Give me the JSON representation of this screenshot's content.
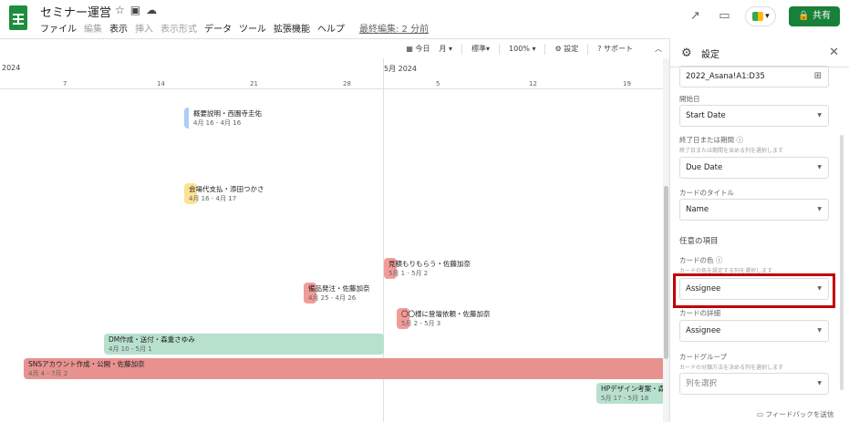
{
  "app": {
    "title": "セミナー運営",
    "menu": [
      "ファイル",
      "編集",
      "表示",
      "挿入",
      "表示形式",
      "データ",
      "ツール",
      "拡張機能",
      "ヘルプ"
    ],
    "menu_disabled": [
      "編集",
      "挿入",
      "表示形式"
    ],
    "last_edit": "最終編集: 2 分前",
    "share_label": "共有"
  },
  "toolbar": {
    "today": "今日",
    "scale": "月",
    "density": "標準",
    "zoom": "100%",
    "settings": "設定",
    "support": "サポート"
  },
  "timeline": {
    "left_month": "2024",
    "month": "5月 2024",
    "days": [
      "7",
      "14",
      "21",
      "28",
      "5",
      "12",
      "19"
    ],
    "cards": [
      {
        "name": "概要説明・西園寺圭佑",
        "dates": "4月 16 - 4月 16",
        "color": "#aecbfa"
      },
      {
        "name": "会場代支払・添田つかさ",
        "dates": "4月 16 - 4月 17",
        "color": "#fde293"
      },
      {
        "name": "見積もりもらう・佐藤加奈",
        "dates": "5月 1 - 5月 2",
        "color": "#f19c99"
      },
      {
        "name": "備品発注・佐藤加奈",
        "dates": "4月 25 - 4月 26",
        "color": "#f19c99"
      },
      {
        "name": "〇〇様に登壇依頼・佐藤加奈",
        "dates": "5月 2 - 5月 3",
        "color": "#f19c99"
      },
      {
        "name": "DM作成・送付・森重さゆみ",
        "dates": "4月 10 - 5月 1",
        "color": "#b7e1cd"
      },
      {
        "name": "SNSアカウント作成・公開・佐藤加奈",
        "dates": "4月 4 - 7月 2",
        "color": "#e8928f"
      },
      {
        "name": "HPデザイン考案・森",
        "dates": "5月 17 - 5月 18",
        "color": "#b7e1cd"
      }
    ]
  },
  "panel": {
    "title": "設定",
    "range_value": "2022_Asana!A1:D35",
    "start_label": "開始日",
    "start_value": "Start Date",
    "end_label": "終了日または期間",
    "end_hint": "終了日または期間を含める列を選択します",
    "end_value": "Due Date",
    "card_title_label": "カードのタイトル",
    "card_title_value": "Name",
    "optional_section": "任意の項目",
    "card_color_label": "カードの色",
    "card_color_hint": "カードの色を設定する列を選択します",
    "card_color_value": "Assignee",
    "card_detail_label": "カードの詳細",
    "card_detail_value": "Assignee",
    "card_group_label": "カードグループ",
    "card_group_hint": "カードの分類方法を決める列を選択します",
    "card_group_placeholder": "列を選択",
    "feedback": "フィードバックを送信"
  }
}
